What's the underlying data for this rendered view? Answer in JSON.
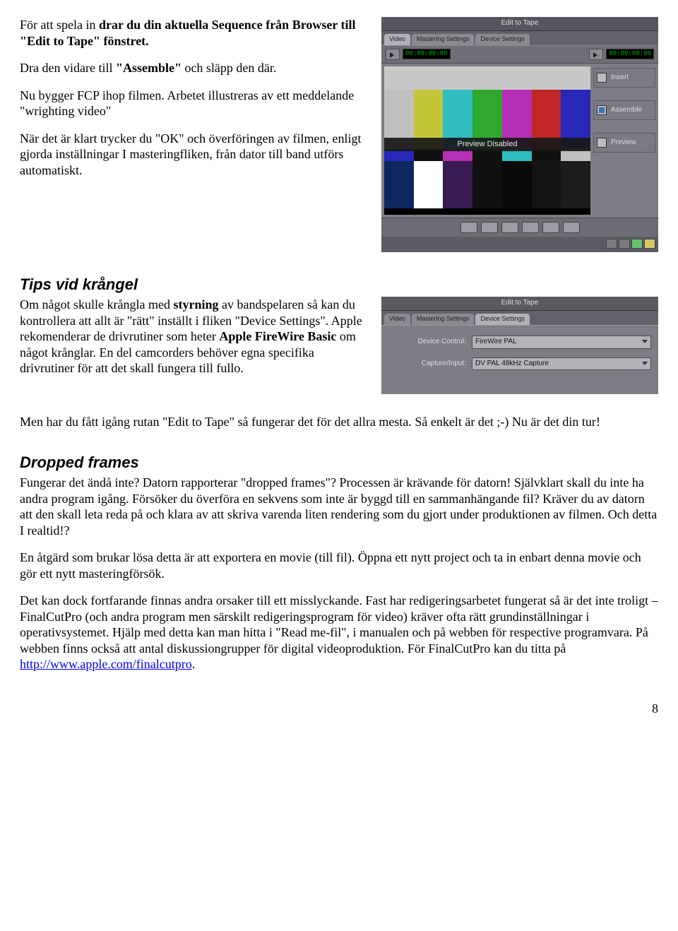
{
  "para1": {
    "pre": "För att spela in ",
    "bold1": "drar du din aktuella Sequence från Browser till \"Edit to Tape\" fönstret.",
    "after": ""
  },
  "para2": {
    "pre": "Dra den vidare till ",
    "bold": "\"Assemble\"",
    "post": " och släpp den där."
  },
  "para3": "Nu bygger FCP ihop filmen. Arbetet illustreras av ett meddelande \"wrighting video\"",
  "para4": "När det är klart trycker du \"OK\" och överföringen av filmen, enligt gjorda inställningar I masteringfliken, från dator till band utförs automatiskt.",
  "tips_heading": "Tips vid krångel",
  "tips_para": {
    "t1": "Om något skulle krångla med ",
    "b1": "styrning",
    "t2": " av bandspelaren så kan du kontrollera att allt är \"rätt\" inställt i fliken \"Device Settings\". Apple rekomenderar de drivrutiner som heter ",
    "b2": "Apple FireWire Basic",
    "t3": " om något krånglar. En del camcorders behöver egna specifika drivrutiner för att det skall fungera till fullo."
  },
  "tips_para2": "Men har du fått igång rutan \"Edit to Tape\" så fungerar det för det allra mesta. Så enkelt är det ;-) Nu är det din tur!",
  "df_heading": "Dropped frames",
  "df_p1": "Fungerar det ändå inte? Datorn rapporterar \"dropped frames\"? Processen är krävande för datorn! Självklart skall du inte ha andra program igång. Försöker du överföra en sekvens som inte är byggd till en sammanhängande fil? Kräver du av datorn att den skall leta reda på och klara av att skriva varenda liten rendering som du gjort under produktionen av filmen. Och detta I realtid!?",
  "df_p2": "En åtgärd som brukar lösa detta är att exportera en movie (till fil). Öppna ett nytt project och ta in enbart denna movie och gör ett nytt masteringförsök.",
  "df_p3_pre": "Det kan dock fortfarande finnas andra orsaker till ett misslyckande. Fast har redigeringsarbetet fungerat så är det inte troligt – FinalCutPro (och andra program men särskilt redigeringsprogram för video) kräver ofta rätt grundinställningar i operativsystemet. Hjälp med detta kan man hitta i \"Read me-fil\", i manualen och på webben för respective programvara. På webben finns också att antal diskussiongrupper för digital videoproduktion. För FinalCutPro kan du titta på ",
  "df_link": "http://www.apple.com/finalcutpro",
  "page_number": "8",
  "ett": {
    "title": "Edit to Tape",
    "tabs": [
      "Video",
      "Mastering Settings",
      "Device Settings"
    ],
    "timecode_left": "00:00:00:00",
    "timecode_right": "00:00:00:00",
    "banner": "Preview Disabled",
    "buttons": {
      "insert": "Insert",
      "assemble": "Assemble",
      "preview": "Preview"
    }
  },
  "ds": {
    "title": "Edit to Tape",
    "tabs": [
      "Video",
      "Mastering Settings",
      "Device Settings"
    ],
    "rows": {
      "device_control_label": "Device Control:",
      "device_control_value": "FireWire PAL",
      "capture_label": "Capture/Input:",
      "capture_value": "DV PAL 48kHz Capture"
    }
  }
}
